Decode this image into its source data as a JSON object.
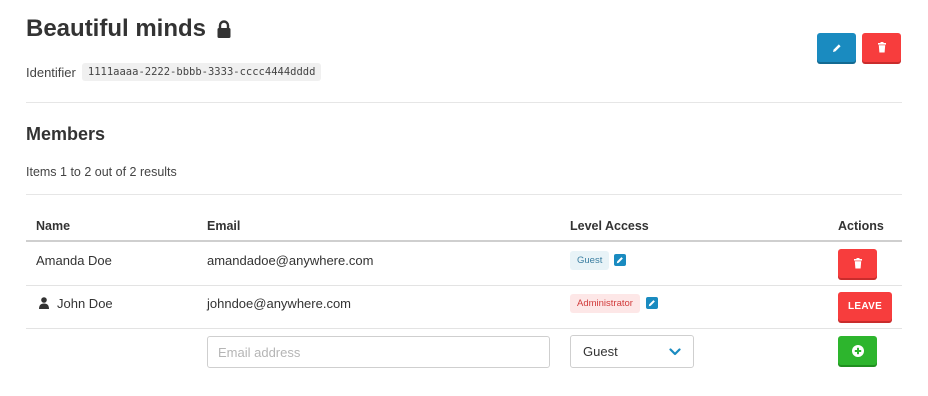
{
  "group": {
    "title": "Beautiful minds",
    "lock_icon": "lock-icon",
    "identifier_label": "Identifier",
    "identifier_value": "1111aaaa-2222-bbbb-3333-cccc4444dddd"
  },
  "header_actions": {
    "edit_icon": "pencil-icon",
    "delete_icon": "trash-icon"
  },
  "members": {
    "title": "Members",
    "items_count": "Items 1 to 2 out of 2 results",
    "columns": [
      "Name",
      "Email",
      "Level Access",
      "Actions"
    ],
    "rows": [
      {
        "name": "Amanda Doe",
        "email": "amandadoe@anywhere.com",
        "level": "Guest",
        "action_icon": "trash-icon"
      },
      {
        "name": "John Doe",
        "email": "johndoe@anywhere.com",
        "level": "Administrator",
        "action_label": "LEAVE",
        "current_user_icon": "user-icon"
      }
    ],
    "add_row": {
      "email_placeholder": "Email address",
      "level_selected": "Guest",
      "add_icon": "plus-circle-icon"
    }
  },
  "colors": {
    "primary": "#1a8bc0",
    "danger": "#f73d3d",
    "success": "#2db52d"
  }
}
